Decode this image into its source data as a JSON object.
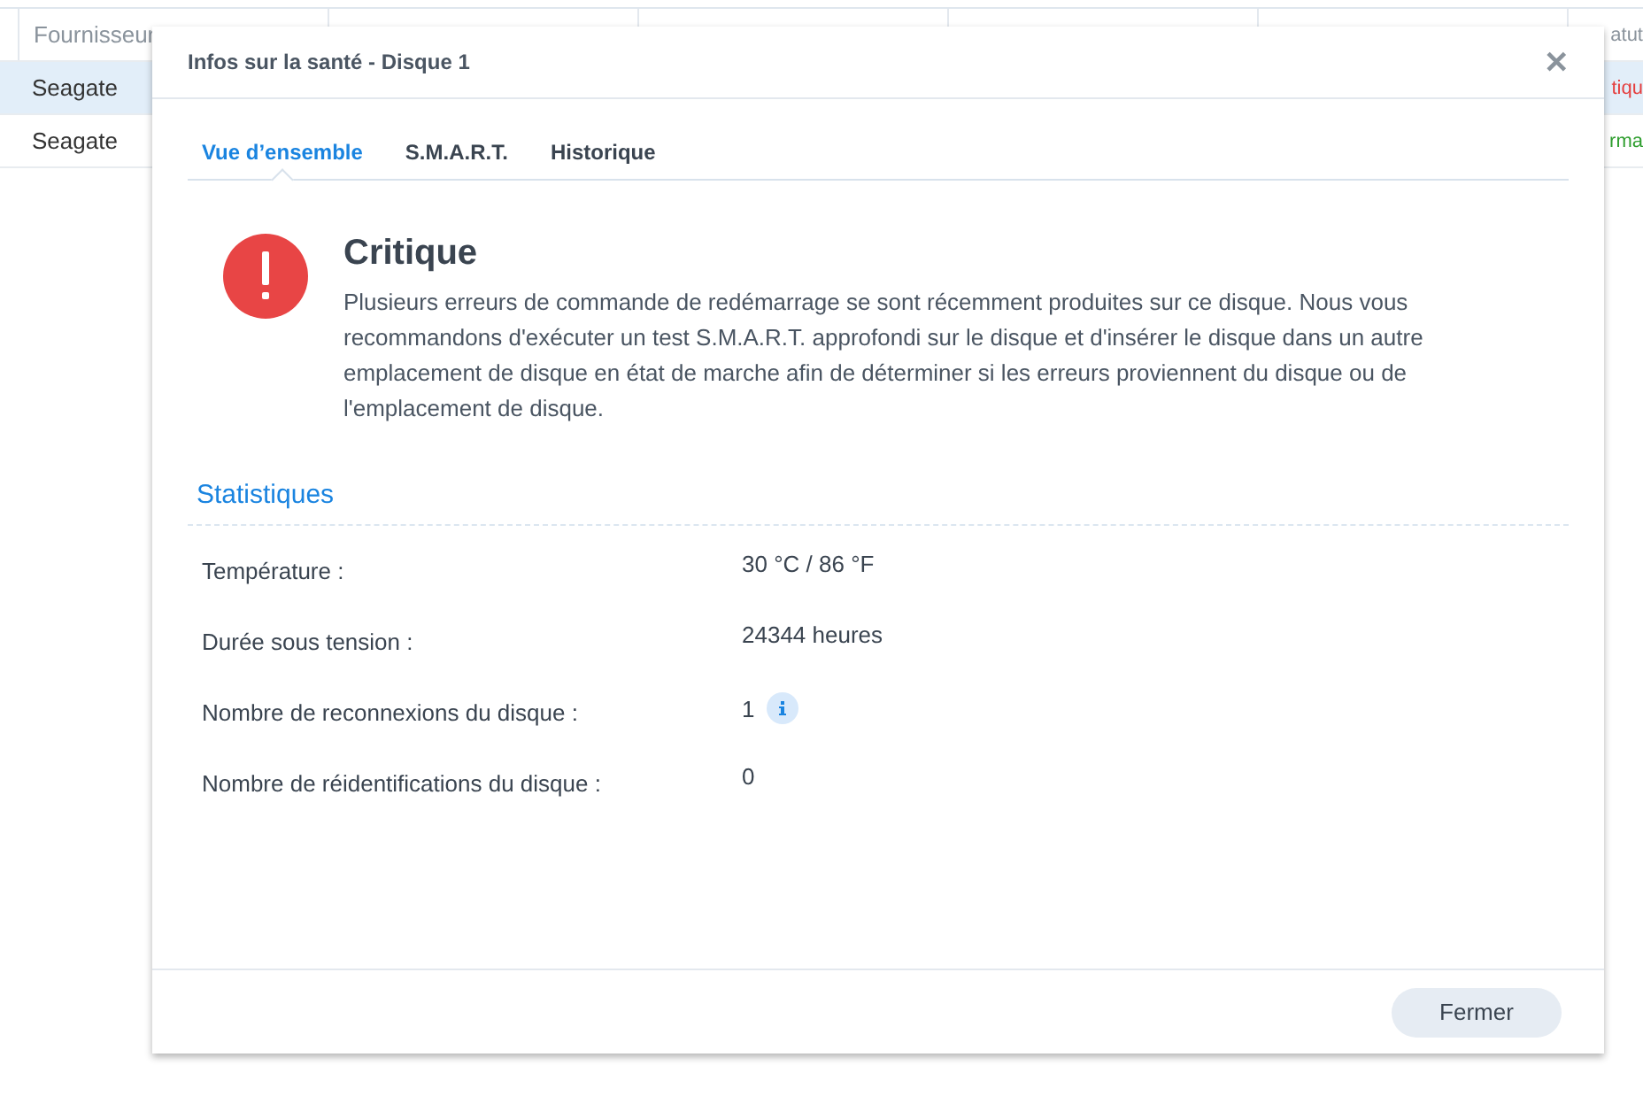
{
  "background_table": {
    "header": {
      "column_1": "Fournisseur",
      "column_6": "atut"
    },
    "rows": [
      {
        "column_1": "Seagate",
        "column_6": "tiqu",
        "color": "#e53e3e",
        "selected": true
      },
      {
        "column_1": "Seagate",
        "column_6": "rma",
        "color": "#2e9e2e",
        "selected": false
      }
    ]
  },
  "dialog": {
    "title": "Infos sur la santé - Disque 1",
    "close": "✕",
    "tabs": [
      {
        "label": "Vue d’ensemble",
        "selected": true
      },
      {
        "label": "S.M.A.R.T.",
        "selected": false
      },
      {
        "label": "Historique",
        "selected": false
      }
    ],
    "alert": {
      "title": "Critique",
      "message": "Plusieurs erreurs de commande de redémarrage se sont récemment produites sur ce disque. Nous vous recommandons d'exécuter un test S.M.A.R.T. approfondi sur le disque et d'insérer le disque dans un autre emplacement de disque en état de marche afin de déterminer si les erreurs proviennent du disque ou de l'emplacement de disque."
    },
    "section_title": "Statistiques",
    "stats": [
      {
        "label": "Température :",
        "value": "30 °C / 86 °F",
        "info": false
      },
      {
        "label": "Durée sous tension :",
        "value": "24344 heures",
        "info": false
      },
      {
        "label": "Nombre de reconnexions du disque :",
        "value": "1",
        "info": true
      },
      {
        "label": "Nombre de réidentifications du disque :",
        "value": "0",
        "info": false
      }
    ],
    "buttons": [
      "Fermer"
    ]
  }
}
